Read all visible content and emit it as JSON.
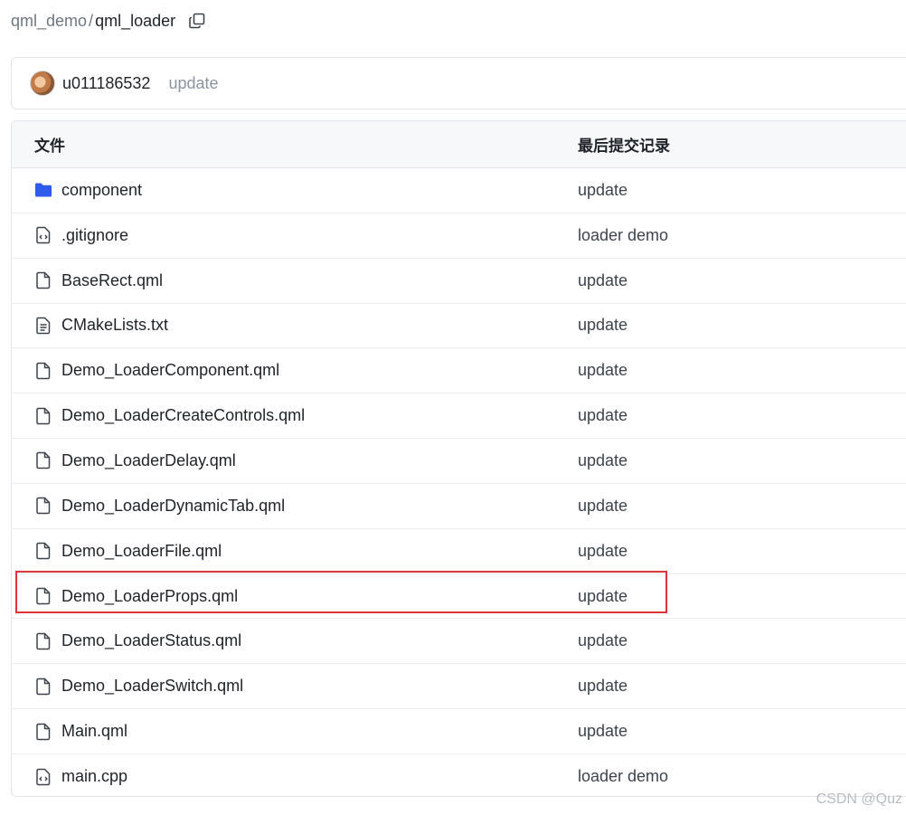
{
  "breadcrumb": {
    "parent": "qml_demo",
    "separator": "/",
    "current": "qml_loader"
  },
  "commit": {
    "user": "u011186532",
    "message": "update"
  },
  "table": {
    "headers": {
      "name": "文件",
      "last_commit": "最后提交记录"
    },
    "rows": [
      {
        "name": "component",
        "commit": "update",
        "icon": "folder-icon"
      },
      {
        "name": ".gitignore",
        "commit": "loader demo",
        "icon": "code-file-icon"
      },
      {
        "name": "BaseRect.qml",
        "commit": "update",
        "icon": "file-icon"
      },
      {
        "name": "CMakeLists.txt",
        "commit": "update",
        "icon": "text-file-icon"
      },
      {
        "name": "Demo_LoaderComponent.qml",
        "commit": "update",
        "icon": "file-icon"
      },
      {
        "name": "Demo_LoaderCreateControls.qml",
        "commit": "update",
        "icon": "file-icon"
      },
      {
        "name": "Demo_LoaderDelay.qml",
        "commit": "update",
        "icon": "file-icon"
      },
      {
        "name": "Demo_LoaderDynamicTab.qml",
        "commit": "update",
        "icon": "file-icon"
      },
      {
        "name": "Demo_LoaderFile.qml",
        "commit": "update",
        "icon": "file-icon"
      },
      {
        "name": "Demo_LoaderProps.qml",
        "commit": "update",
        "icon": "file-icon"
      },
      {
        "name": "Demo_LoaderStatus.qml",
        "commit": "update",
        "icon": "file-icon"
      },
      {
        "name": "Demo_LoaderSwitch.qml",
        "commit": "update",
        "icon": "file-icon"
      },
      {
        "name": "Main.qml",
        "commit": "update",
        "icon": "file-icon"
      },
      {
        "name": "main.cpp",
        "commit": "loader demo",
        "icon": "code-file-icon"
      }
    ]
  },
  "colors": {
    "folder": "#2f5bea",
    "highlight": "#e0343a"
  },
  "watermark": "CSDN @Quz"
}
